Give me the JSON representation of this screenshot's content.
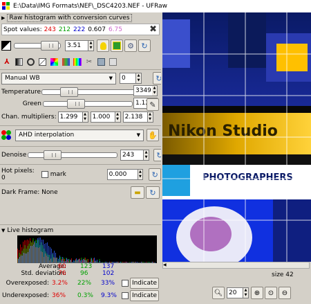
{
  "window": {
    "title": "E:\\Data\\IMG Formats\\NEF\\_DSC4203.NEF - UFRaw"
  },
  "histogram_expander": {
    "label": "Raw histogram with conversion curves"
  },
  "spot_values": {
    "label": "Spot values:",
    "r": "243",
    "g": "212",
    "b": "222",
    "lum": "0.607",
    "ev": "6.75"
  },
  "exposure": {
    "value": "3.51"
  },
  "white_balance": {
    "preset": "Manual WB",
    "fine_tune": "0"
  },
  "temperature": {
    "label": "Temperature",
    "value": "3349",
    "fraction": 0.3
  },
  "green": {
    "label": "Green",
    "value": "1.123",
    "fraction": 0.35
  },
  "chan_multipliers": {
    "label": "Chan. multipliers:",
    "r": "1.299",
    "g": "1.000",
    "b": "2.138"
  },
  "interpolation": {
    "value": "AHD interpolation"
  },
  "denoise": {
    "label": "Denoise",
    "value": "243",
    "fraction": 0.33
  },
  "hot_pixels": {
    "label": "Hot pixels: 0",
    "mark_label": "mark",
    "value": "0.000"
  },
  "dark_frame": {
    "label": "Dark Frame: None"
  },
  "live_histogram": {
    "label": "Live histogram",
    "average_label": "Average:",
    "stddev_label": "Std. deviation:",
    "over_label": "Overexposed:",
    "under_label": "Underexposed:",
    "average": {
      "r": "60",
      "g": "123",
      "b": "137"
    },
    "stddev": {
      "r": "76",
      "g": "96",
      "b": "102"
    },
    "over": {
      "r": "3.2%",
      "g": "22%",
      "b": "33%"
    },
    "under": {
      "r": "36%",
      "g": "0.3%",
      "b": "9.3%"
    },
    "indicate_label": "Indicate"
  },
  "preview": {
    "text_top": "Nikon Studio",
    "text_banner": "PHOTOGRAPHERS",
    "size_label": "size 42",
    "zoom_value": "20"
  },
  "colors": {
    "red": "#e00000",
    "green": "#00a000",
    "blue": "#0000cc",
    "mag": "#cc66cc"
  }
}
